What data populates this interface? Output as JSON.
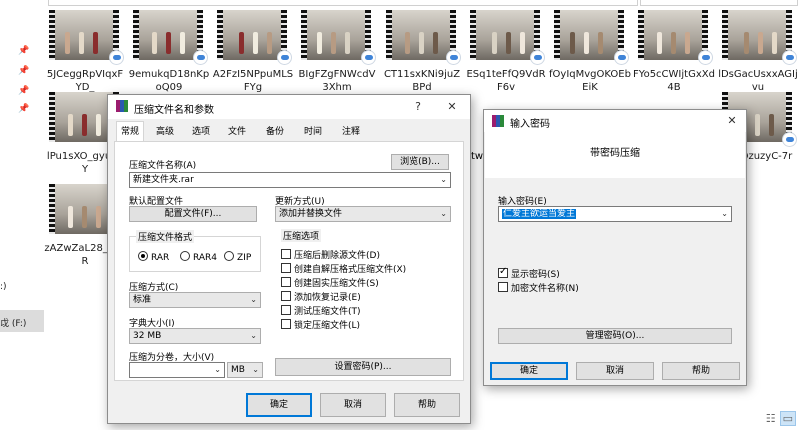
{
  "explorer": {
    "nav_drive_c": ":)",
    "nav_drive_f": "戉 (F:)",
    "files_row1": [
      {
        "label": "5JCeggRpVIqxFYD_"
      },
      {
        "label": "9emukqD18nKpoQ09"
      },
      {
        "label": "A2FzI5NPpuMLSFYg"
      },
      {
        "label": "BIgFZgFNWcdV3Xhm"
      },
      {
        "label": "CT11sxKNi9juZBPd"
      },
      {
        "label": "ESq1teFfQ9VdRF6v"
      },
      {
        "label": "fOyIqMvgOKOEbEiK"
      },
      {
        "label": "FYo5cCWIjtGxXd4B"
      },
      {
        "label": "lDsGacUsxxAGIjvu"
      }
    ],
    "files_row2": [
      {
        "label": "lPu1sXO_gyuTkY"
      },
      {
        "label": "tw 91"
      },
      {
        "label": "r52QzuzyC-7r"
      }
    ],
    "files_row3": [
      {
        "label": "zAZwZaL28_EycR"
      }
    ],
    "view_icons": [
      "details-icon",
      "large-icons-icon"
    ]
  },
  "archive_dialog": {
    "title": "压缩文件名和参数",
    "help_btn": "?",
    "close_btn": "✕",
    "tabs": [
      "常规",
      "高级",
      "选项",
      "文件",
      "备份",
      "时间",
      "注释"
    ],
    "active_tab": "常规",
    "archive_name_label": "压缩文件名称(A)",
    "browse_btn": "浏览(B)...",
    "archive_name_value": "新建文件夹.rar",
    "default_profile_label": "默认配置文件",
    "profile_btn": "配置文件(F)...",
    "update_mode_label": "更新方式(U)",
    "update_mode_value": "添加并替换文件",
    "format_group": "压缩文件格式",
    "formats": [
      "RAR",
      "RAR4",
      "ZIP"
    ],
    "selected_format": "RAR",
    "method_label": "压缩方式(C)",
    "method_value": "标准",
    "dict_label": "字典大小(I)",
    "dict_value": "32 MB",
    "split_label": "压缩为分卷，大小(V)",
    "split_value": "",
    "split_unit": "MB",
    "options_group": "压缩选项",
    "options": [
      {
        "label": "压缩后删除源文件(D)",
        "checked": false
      },
      {
        "label": "创建自解压格式压缩文件(X)",
        "checked": false
      },
      {
        "label": "创建固实压缩文件(S)",
        "checked": false
      },
      {
        "label": "添加恢复记录(E)",
        "checked": false
      },
      {
        "label": "测试压缩文件(T)",
        "checked": false
      },
      {
        "label": "锁定压缩文件(L)",
        "checked": false
      }
    ],
    "set_password_btn": "设置密码(P)...",
    "ok_btn": "确定",
    "cancel_btn": "取消",
    "help_bottom_btn": "帮助"
  },
  "password_dialog": {
    "title": "输入密码",
    "close_btn": "✕",
    "heading": "带密码压缩",
    "password_label": "输入密码(E)",
    "password_value": "仁爱主欲运当爱主",
    "show_password_label": "显示密码(S)",
    "show_password_checked": true,
    "encrypt_names_label": "加密文件名称(N)",
    "encrypt_names_checked": false,
    "manage_btn": "管理密码(O)...",
    "ok_btn": "确定",
    "cancel_btn": "取消",
    "help_btn": "帮助"
  }
}
